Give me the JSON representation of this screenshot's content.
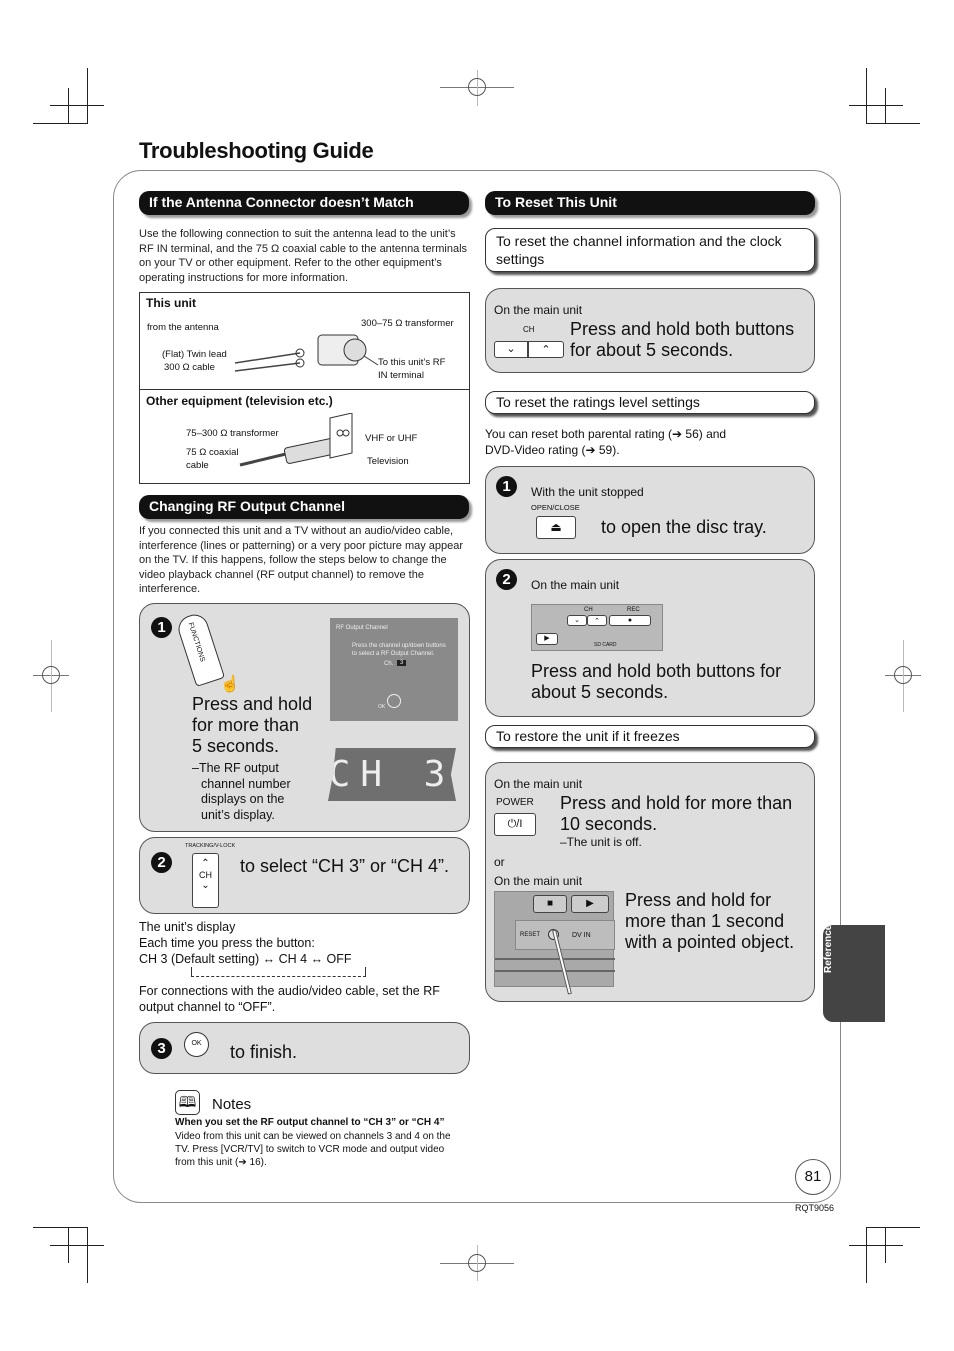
{
  "page": {
    "title": "Troubleshooting Guide",
    "page_number": "81",
    "doc_code": "RQT9056",
    "side_tab": "Reference"
  },
  "antenna": {
    "header": "If the Antenna Connector doesn’t Match",
    "intro": "Use the following connection to suit the antenna lead to the unit’s RF IN terminal, and the 75 Ω coaxial cable to the antenna terminals on your TV or other equipment. Refer to the other equipment’s operating instructions for more information.",
    "this_unit": {
      "label": "This unit",
      "from_antenna": "from the antenna",
      "twin_lead": "(Flat) Twin lead",
      "twin_lead_2": "300 Ω cable",
      "transformer": "300–75 Ω transformer",
      "to_rf_1": "To this unit’s RF",
      "to_rf_2": "IN terminal"
    },
    "other": {
      "label": "Other equipment (television etc.)",
      "transformer": "75–300 Ω transformer",
      "coax_1": "75 Ω coaxial",
      "coax_2": "cable",
      "vhf": "VHF or UHF",
      "tv": "Television"
    }
  },
  "rf": {
    "header": "Changing RF Output Channel",
    "intro": "If you connected this unit and a TV without an audio/video cable, interference (lines or patterning) or a very poor picture may appear on the TV. If this happens, follow the steps below to change the video playback channel (RF output channel) to remove the interference.",
    "step1": {
      "num": "1",
      "button_label": "FUNCTIONS",
      "instruction_1": "Press and hold",
      "instruction_2": "for more than",
      "instruction_3": "5 seconds.",
      "note_1": "–The RF output",
      "note_2": "channel number",
      "note_3": "displays on the",
      "note_4": "unit’s display.",
      "screen_title": "RF Output Channel",
      "screen_msg_1": "Press the channel up/down buttons",
      "screen_msg_2": "to select a RF Output Channel.",
      "screen_ch_label": "Ch.",
      "screen_ch_value": "3",
      "screen_ok": "OK",
      "lcd_text": "CH 3"
    },
    "step2": {
      "num": "2",
      "button_caption": "TRACKING/V-LOCK",
      "button_label": "CH",
      "instruction": "to select “CH 3” or “CH 4”."
    },
    "display_note": {
      "line1": "The unit’s display",
      "line2": "Each time you press the button:",
      "line3": "CH 3 (Default setting) ↔ CH 4 ↔ OFF",
      "line4": "For connections with the audio/video cable, set the RF output channel to “OFF”."
    },
    "step3": {
      "num": "3",
      "button_label": "OK",
      "instruction": "to finish."
    },
    "notes": {
      "title": "Notes",
      "bold": "When you set the RF output channel to “CH 3” or “CH 4”",
      "text": "Video from this unit can be viewed on channels 3 and 4 on the TV. Press [VCR/TV] to switch to VCR mode and output video from this unit (➔ 16)."
    }
  },
  "reset": {
    "header": "To Reset This Unit",
    "channel_clock": {
      "title": "To reset the channel information and the clock settings",
      "on_main": "On the main unit",
      "ch_label": "CH",
      "down": "⌄",
      "up": "⌃",
      "instruction_1": "Press and hold both buttons",
      "instruction_2": "for about 5 seconds."
    },
    "ratings": {
      "title": "To reset the ratings level settings",
      "desc_1": "You can reset both parental rating (➔ 56) and",
      "desc_2": "DVD-Video rating (➔ 59).",
      "step1": {
        "num": "1",
        "condition": "With the unit stopped",
        "button_caption": "OPEN/CLOSE",
        "button_symbol": "⏏",
        "instruction": "to open the disc tray."
      },
      "step2": {
        "num": "2",
        "on_main": "On the main unit",
        "panel_ch": "CH",
        "panel_rec": "REC",
        "panel_sd": "SD CARD",
        "instruction_1": "Press and hold both buttons for",
        "instruction_2": "about 5 seconds."
      }
    },
    "freeze": {
      "title": "To restore the unit if it freezes",
      "on_main_1": "On the main unit",
      "power_caption": "POWER",
      "power_symbol": "⏻/I",
      "instruction_1a": "Press and hold for more than",
      "instruction_1b": "10 seconds.",
      "note": "–The unit is off.",
      "or": "or",
      "on_main_2": "On the main unit",
      "reset_label": "RESET",
      "dvin_label": "DV IN",
      "instruction_2a": "Press and hold for",
      "instruction_2b": "more than 1 second",
      "instruction_2c": "with a pointed object."
    }
  }
}
